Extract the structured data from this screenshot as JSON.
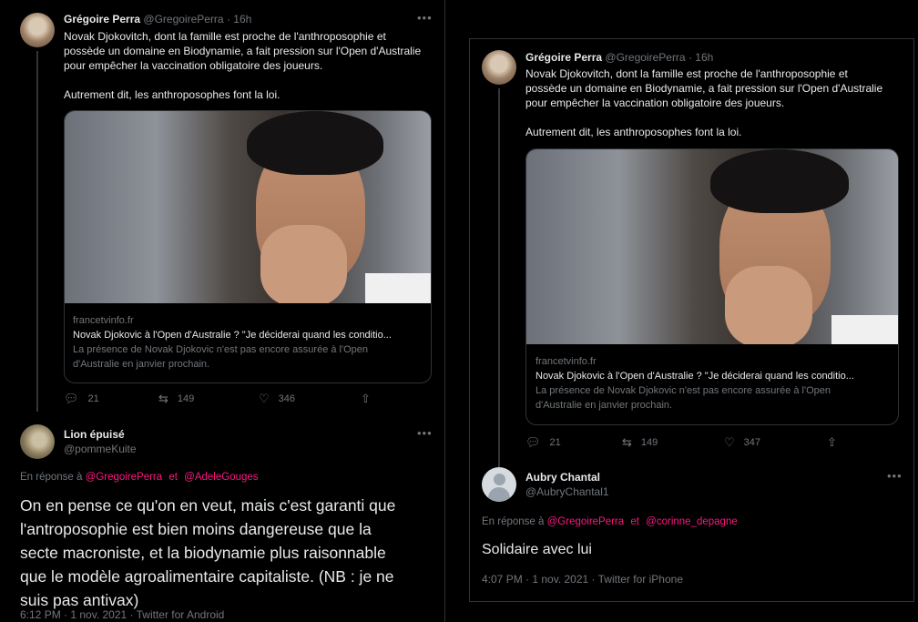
{
  "left": {
    "tweet": {
      "author_name": "Grégoire Perra",
      "author_handle": "@GregoirePerra",
      "separator": "·",
      "time": "16h",
      "more_icon": "more-icon",
      "text_line1": "Novak Djokovitch, dont la famille est proche de l'anthroposophie et",
      "text_line2": "possède un domaine en Biodynamie, a fait pression sur l'Open d'Australie",
      "text_line3": "pour empêcher la vaccination obligatoire des joueurs.",
      "text_line4": "Autrement dit, les anthroposophes font la loi.",
      "card": {
        "domain": "francetvinfo.fr",
        "title": "Novak Djokovic à l'Open d'Australie ? \"Je déciderai quand les conditio...",
        "desc_line1": "La présence de Novak Djokovic n'est pas encore assurée à l'Open",
        "desc_line2": "d'Australie en janvier prochain."
      },
      "actions": {
        "replies": "21",
        "retweets": "149",
        "likes": "346"
      }
    },
    "reply": {
      "author_name": "Lion épuisé",
      "author_handle": "@pommeKuite",
      "replying_prefix": "En réponse à",
      "mention1": "@GregoirePerra",
      "and": "et",
      "mention2": "@AdeleGouges",
      "text_line1": "On en pense ce qu'on en veut, mais c'est garanti que",
      "text_line2": "l'antroposophie est bien moins dangereuse que la",
      "text_line3": "secte macroniste, et la biodynamie plus raisonnable",
      "text_line4": "que le modèle agroalimentaire capitaliste. (NB : je ne",
      "text_line5": "suis pas antivax)",
      "footer": "6:12 PM · 1 nov. 2021 · Twitter for Android"
    }
  },
  "right": {
    "tweet": {
      "author_name": "Grégoire Perra",
      "author_handle": "@GregoirePerra",
      "separator": "·",
      "time": "16h",
      "text_line1": "Novak Djokovitch, dont la famille est proche de l'anthroposophie et",
      "text_line2": "possède un domaine en Biodynamie, a fait pression sur l'Open d'Australie",
      "text_line3": "pour empêcher la vaccination obligatoire des joueurs.",
      "text_line4": "Autrement dit, les anthroposophes font la loi.",
      "card": {
        "domain": "francetvinfo.fr",
        "title": "Novak Djokovic à l'Open d'Australie ? \"Je déciderai quand les conditio...",
        "desc_line1": "La présence de Novak Djokovic n'est pas encore assurée à l'Open",
        "desc_line2": "d'Australie en janvier prochain."
      },
      "actions": {
        "replies": "21",
        "retweets": "149",
        "likes": "347"
      }
    },
    "reply": {
      "author_name": "Aubry Chantal",
      "author_handle": "@AubryChantal1",
      "replying_prefix": "En réponse à",
      "mention1": "@GregoirePerra",
      "and": "et",
      "mention2": "@corinne_depagne",
      "text": "Solidaire avec lui",
      "footer": "4:07 PM · 1 nov. 2021 · Twitter for iPhone"
    }
  },
  "colors": {
    "background": "#000000",
    "text": "#e7e9ea",
    "muted": "#71767b",
    "mention": "#f91880",
    "border": "#2f3336"
  }
}
